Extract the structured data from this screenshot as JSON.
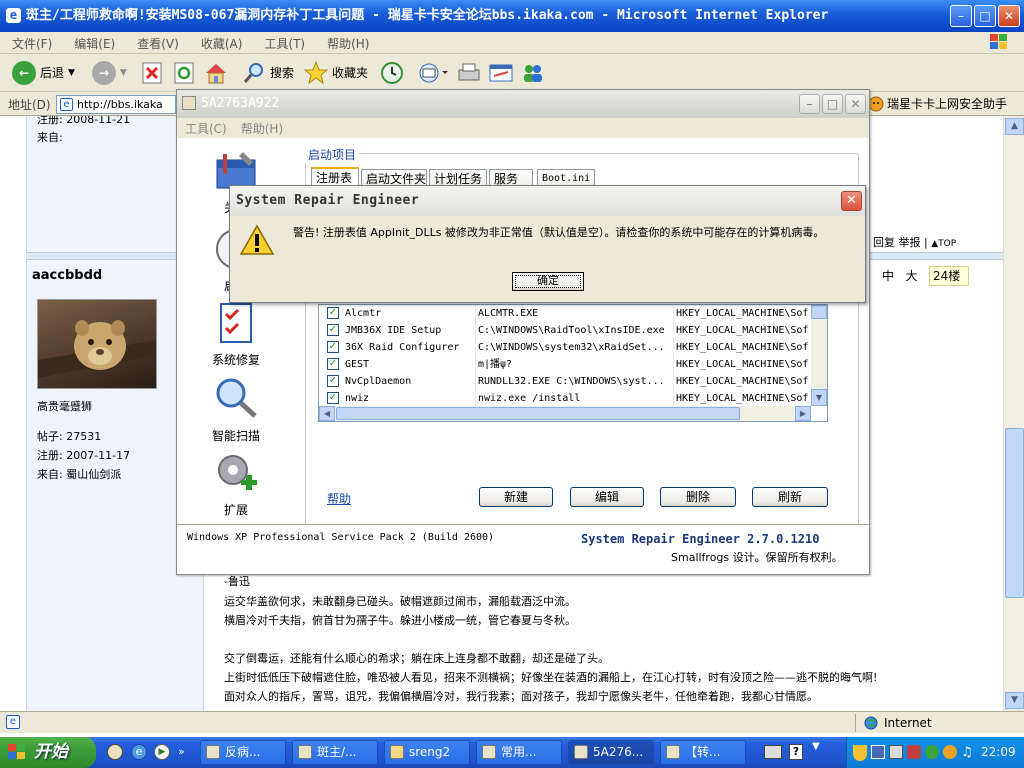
{
  "ie": {
    "title": "斑主/工程师救命啊!安装MS08-067漏洞内存补丁工具问题 - 瑞星卡卡安全论坛bbs.ikaka.com - Microsoft Internet Explorer",
    "menu": [
      "文件(F)",
      "编辑(E)",
      "查看(V)",
      "收藏(A)",
      "工具(T)",
      "帮助(H)"
    ],
    "toolbar": {
      "back": "后退",
      "search": "搜索",
      "favorites": "收藏夹"
    },
    "address_label": "地址(D)",
    "address_value": "http://bbs.ikaka",
    "addon": "瑞星卡卡上网安全助手",
    "status_zone": "Internet"
  },
  "forum": {
    "prev_post": {
      "reg_label": "注册:",
      "reg_value": "2008-11-21",
      "from_label": "来自:"
    },
    "post_actions": {
      "reply": "回复",
      "report": "举报",
      "top": "TOP",
      "sep": "|"
    },
    "font_sizes": {
      "mid": "中",
      "big": "大"
    },
    "floor": "24楼",
    "user": {
      "name": "aaccbbdd",
      "title": "高贵毫蹙狮",
      "posts_label": "帖子:",
      "posts_value": "27531",
      "reg_label": "注册:",
      "reg_value": "2007-11-17",
      "from_label": "来自:",
      "from_value": "蜀山仙剑派"
    },
    "post_lines": [
      "-鲁迅",
      "运交华盖欲何求，未敢翻身已碰头。破帽遮颜过闹市，漏船载酒泛中流。",
      "横眉冷对千夫指，俯首甘为孺子牛。躲进小楼成一统，管它春夏与冬秋。",
      "",
      "交了倒霉运，还能有什么顺心的希求；躺在床上连身都不敢翻，却还是碰了头。",
      "上街时低低压下破帽遮住脸，唯恐被人看见，招来不测横祸；好像坐在装酒的漏船上，在江心打转，时有没顶之险——逃不脱的晦气啊!",
      "面对众人的指斥，詈骂，诅咒，我偏偏横眉冷对，我行我素；面对孩子，我却宁愿像头老牛，任他牵着跑，我都心甘情愿。"
    ]
  },
  "sre": {
    "title": "5A2763A922",
    "menu": [
      "工具(C)",
      "帮助(H)"
    ],
    "sidebar": [
      "关于",
      "启动",
      "系统修复",
      "智能扫描",
      "扩展"
    ],
    "group_label": "启动项目",
    "tabs": [
      "注册表",
      "启动文件夹",
      "计划任务",
      "服务",
      "Boot.ini"
    ],
    "rows": [
      {
        "name": "Alcmtr",
        "cmd": "ALCMTR.EXE",
        "key": "HKEY_LOCAL_MACHINE\\Sof"
      },
      {
        "name": "JMB36X IDE Setup",
        "cmd": "C:\\WINDOWS\\RaidTool\\xInsIDE.exe",
        "key": "HKEY_LOCAL_MACHINE\\Sof"
      },
      {
        "name": "36X Raid Configurer",
        "cmd": "C:\\WINDOWS\\system32\\xRaidSet...",
        "key": "HKEY_LOCAL_MACHINE\\Sof"
      },
      {
        "name": "GEST",
        "cmd": "m|播ψ?",
        "key": "HKEY_LOCAL_MACHINE\\Sof"
      },
      {
        "name": "NvCplDaemon",
        "cmd": "RUNDLL32.EXE C:\\WINDOWS\\syst...",
        "key": "HKEY_LOCAL_MACHINE\\Sof"
      },
      {
        "name": "nwiz",
        "cmd": "nwiz.exe /install",
        "key": "HKEY_LOCAL_MACHINE\\Sof"
      }
    ],
    "help_link": "帮助",
    "buttons": [
      "新建",
      "编辑",
      "删除",
      "刷新"
    ],
    "os_info": "Windows XP Professional Service Pack 2 (Build 2600)",
    "product": "System Repair Engineer 2.7.0.1210",
    "credit": "Smallfrogs 设计。保留所有权利。"
  },
  "dialog": {
    "title": "System Repair Engineer",
    "message": "警告! 注册表值 AppInit_DLLs 被修改为非正常值（默认值是空）。请检查你的系统中可能存在的计算机病毒。",
    "ok": "确定"
  },
  "taskbar": {
    "start": "开始",
    "tasks": [
      "反病...",
      "斑主/...",
      "sreng2",
      "常用...",
      "5A276...",
      "【转..."
    ],
    "clock": "22:09"
  },
  "colors": {
    "xp_blue": "#245edb",
    "start_green": "#3a9a35",
    "link_blue": "#1a4aa8"
  }
}
